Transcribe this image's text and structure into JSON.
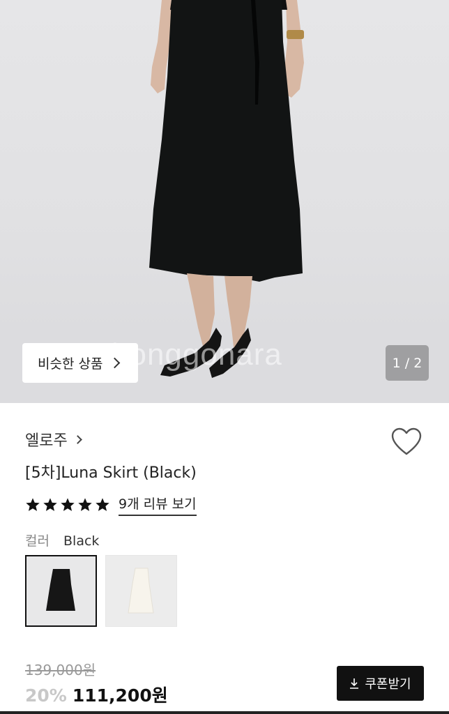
{
  "gallery": {
    "watermark": "bonggonara",
    "similar_button_label": "비슷한 상품",
    "page_indicator": "1 / 2"
  },
  "product": {
    "brand": "엘로주",
    "title": "[5차]Luna Skirt (Black)",
    "rating_stars": 5,
    "review_link": "9개 리뷰 보기",
    "color_label": "컬러",
    "color_value": "Black",
    "swatches": [
      {
        "color": "Black",
        "selected": true,
        "hex": "#141414"
      },
      {
        "color": "Ivory",
        "selected": false,
        "hex": "#f6f3ea"
      }
    ]
  },
  "price": {
    "original": "139,000원",
    "discount": "20%",
    "sale": "111,200원"
  },
  "coupon": {
    "label": "쿠폰받기"
  }
}
